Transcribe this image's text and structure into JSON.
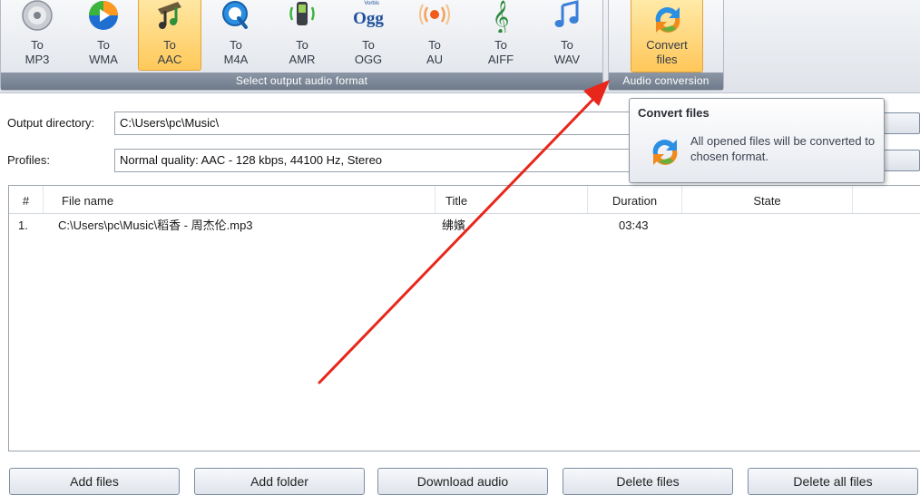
{
  "ribbon": {
    "format_group_caption": "Select output audio format",
    "conversion_group_caption": "Audio conversion",
    "formats": [
      {
        "line1": "To",
        "line2": "MP3",
        "icon": "mp3-disc-icon",
        "selected": false
      },
      {
        "line1": "To",
        "line2": "WMA",
        "icon": "wma-player-icon",
        "selected": false
      },
      {
        "line1": "To",
        "line2": "AAC",
        "icon": "aac-note-icon",
        "selected": true
      },
      {
        "line1": "To",
        "line2": "M4A",
        "icon": "m4a-quicktime-icon",
        "selected": false
      },
      {
        "line1": "To",
        "line2": "AMR",
        "icon": "amr-phone-icon",
        "selected": false
      },
      {
        "line1": "To",
        "line2": "OGG",
        "icon": "ogg-vorbis-icon",
        "selected": false
      },
      {
        "line1": "To",
        "line2": "AU",
        "icon": "au-wave-icon",
        "selected": false
      },
      {
        "line1": "To",
        "line2": "AIFF",
        "icon": "aiff-clef-icon",
        "selected": false
      },
      {
        "line1": "To",
        "line2": "WAV",
        "icon": "wav-note-icon",
        "selected": false
      }
    ],
    "ogg_icon_text": "Ogg",
    "vorbis_text": "Vorbis",
    "convert": {
      "line1": "Convert",
      "line2": "files"
    }
  },
  "form": {
    "output_label": "Output directory:",
    "output_value": "C:\\Users\\pc\\Music\\",
    "profiles_label": "Profiles:",
    "profiles_value": "Normal quality: AAC - 128 kbps, 44100 Hz, Stereo"
  },
  "list": {
    "columns": [
      "#",
      "File name",
      "Title",
      "Duration",
      "State"
    ],
    "rows": [
      {
        "num": "1.",
        "file": "C:\\Users\\pc\\Music\\稻香 - 周杰伦.mp3",
        "title": "绋嬪",
        "duration": "03:43",
        "state": ""
      }
    ]
  },
  "buttons": {
    "add_files": "Add files",
    "add_folder": "Add folder",
    "download_audio": "Download audio",
    "delete_files": "Delete files",
    "delete_all_files": "Delete all files"
  },
  "tooltip": {
    "title": "Convert files",
    "body": "All opened files will be converted to chosen format."
  },
  "colors": {
    "selected_gradient_top": "#ffe7a3",
    "selected_gradient_bottom": "#ffc95a",
    "annotation_arrow": "#e8271c",
    "group_caption_bg": "#7a8596"
  }
}
